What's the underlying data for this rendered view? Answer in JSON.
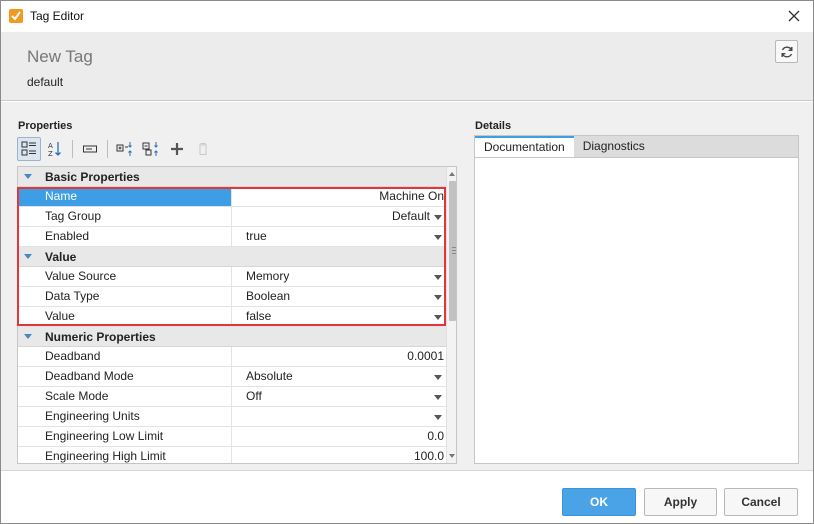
{
  "window": {
    "title": "Tag Editor"
  },
  "header": {
    "tag_name": "New Tag",
    "provider": "default"
  },
  "properties": {
    "section_title": "Properties",
    "rows": [
      {
        "type": "category",
        "label": "Basic Properties"
      },
      {
        "type": "prop",
        "name": "Name",
        "value": "Machine On",
        "align": "right",
        "dropdown": false,
        "selected": true
      },
      {
        "type": "prop",
        "name": "Tag Group",
        "value": "Default",
        "align": "right",
        "dropdown": true
      },
      {
        "type": "prop",
        "name": "Enabled",
        "value": "true",
        "align": "left",
        "dropdown": true
      },
      {
        "type": "category",
        "label": "Value"
      },
      {
        "type": "prop",
        "name": "Value Source",
        "value": "Memory",
        "align": "left",
        "dropdown": true
      },
      {
        "type": "prop",
        "name": "Data Type",
        "value": "Boolean",
        "align": "left",
        "dropdown": true
      },
      {
        "type": "prop",
        "name": "Value",
        "value": "false",
        "align": "left",
        "dropdown": true
      },
      {
        "type": "category",
        "label": "Numeric Properties"
      },
      {
        "type": "prop",
        "name": "Deadband",
        "value": "0.0001",
        "align": "right",
        "dropdown": false
      },
      {
        "type": "prop",
        "name": "Deadband Mode",
        "value": "Absolute",
        "align": "left",
        "dropdown": true
      },
      {
        "type": "prop",
        "name": "Scale Mode",
        "value": "Off",
        "align": "left",
        "dropdown": true
      },
      {
        "type": "prop",
        "name": "Engineering Units",
        "value": "",
        "align": "left",
        "dropdown": true
      },
      {
        "type": "prop",
        "name": "Engineering Low Limit",
        "value": "0.0",
        "align": "right",
        "dropdown": false
      },
      {
        "type": "prop",
        "name": "Engineering High Limit",
        "value": "100.0",
        "align": "right",
        "dropdown": false
      }
    ]
  },
  "details": {
    "section_title": "Details",
    "tabs": [
      {
        "label": "Documentation",
        "active": true
      },
      {
        "label": "Diagnostics",
        "active": false
      }
    ]
  },
  "footer": {
    "ok_label": "OK",
    "apply_label": "Apply",
    "cancel_label": "Cancel"
  },
  "colors": {
    "accent": "#3d9ee6",
    "highlight": "#e3353a",
    "app_icon": "#f39a1e"
  }
}
